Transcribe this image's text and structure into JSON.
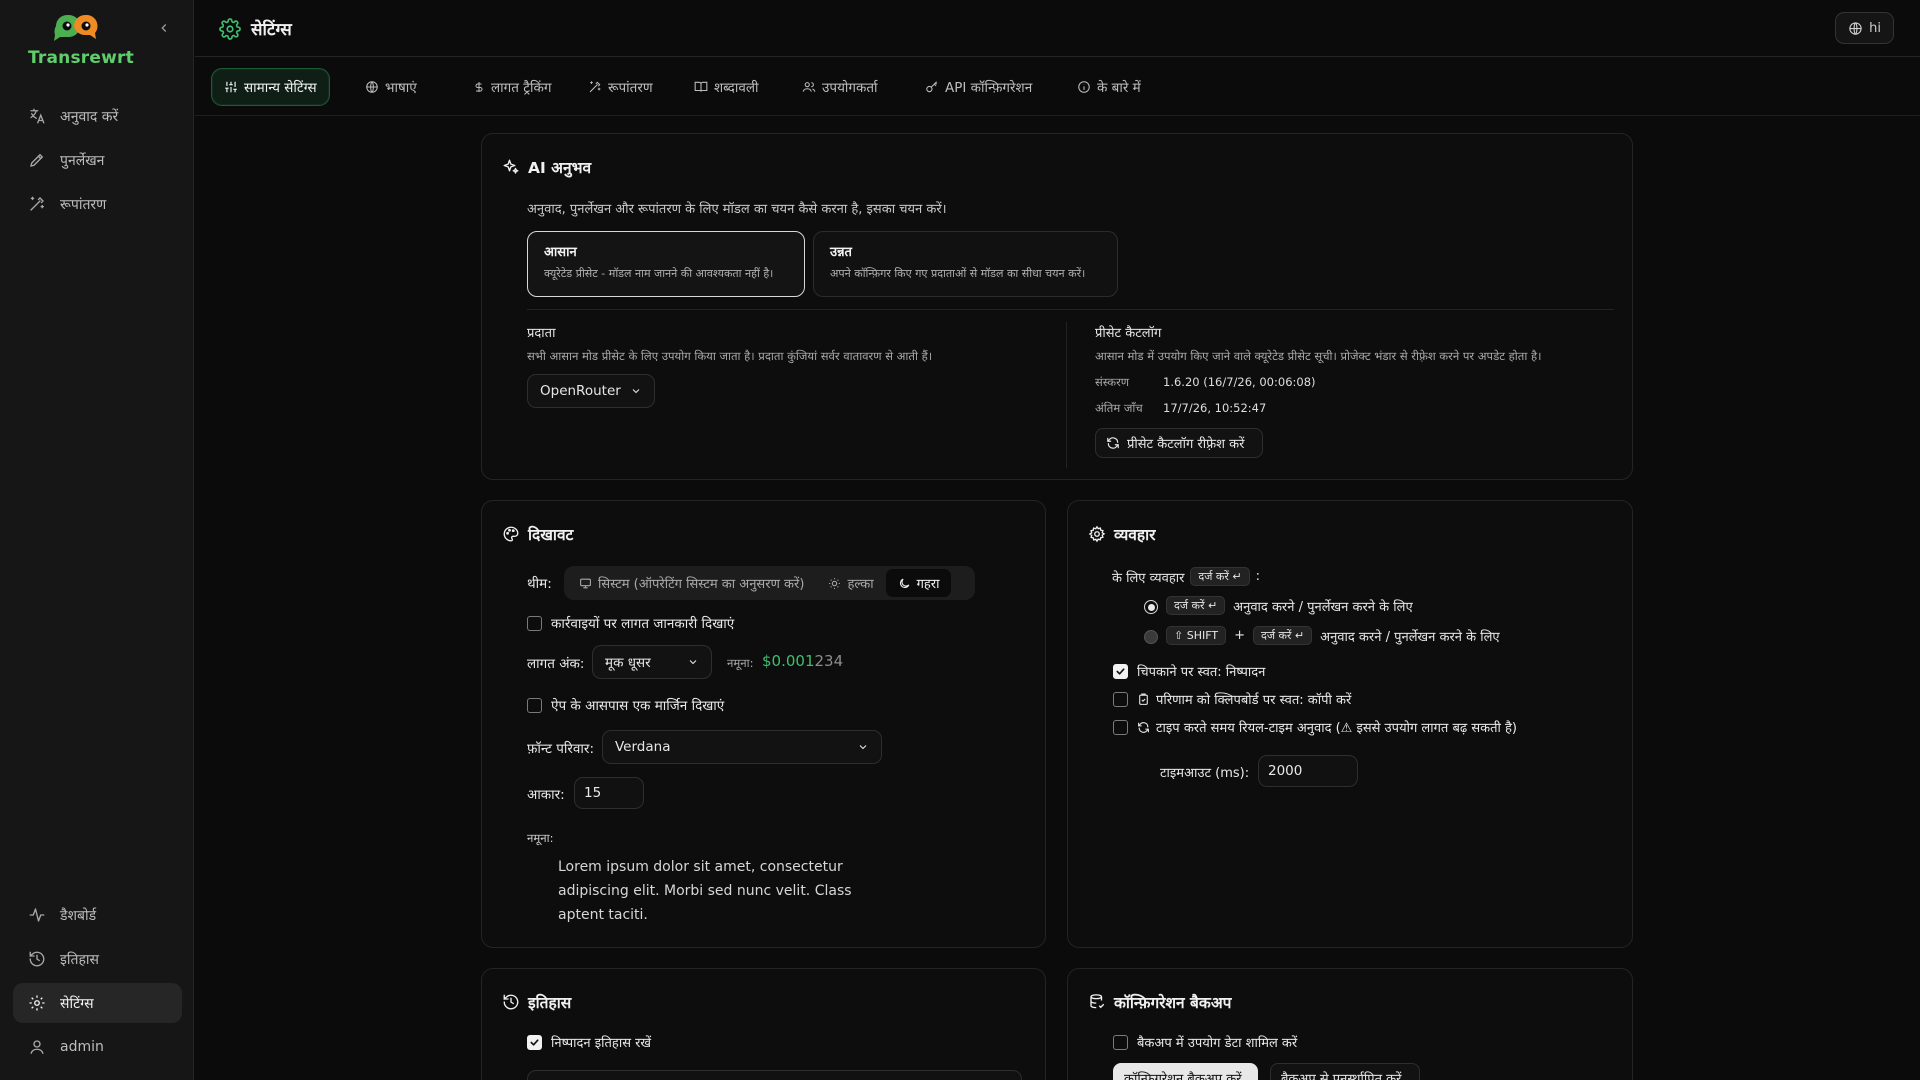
{
  "app": {
    "name": "Transrewrt",
    "brand_color": "#5fcf6b",
    "accent_color": "#3fbf6f"
  },
  "sidebar": {
    "top_items": [
      {
        "label": "अनुवाद करें",
        "icon": "translate-icon"
      },
      {
        "label": "पुनर्लेखन",
        "icon": "rewrite-icon"
      },
      {
        "label": "रूपांतरण",
        "icon": "wand-icon"
      }
    ],
    "bottom_items": [
      {
        "label": "डैशबोर्ड",
        "icon": "activity-icon"
      },
      {
        "label": "इतिहास",
        "icon": "history-icon"
      },
      {
        "label": "सेटिंग्स",
        "icon": "gear-icon",
        "active": true
      },
      {
        "label": "admin",
        "icon": "user-icon"
      }
    ]
  },
  "header": {
    "title": "सेटिंग्स",
    "language": "hi"
  },
  "tabs": [
    {
      "label": "सामान्य सेटिंग्स",
      "icon": "sliders-icon",
      "active": true
    },
    {
      "label": "भाषाएं",
      "icon": "globe-icon"
    },
    {
      "label": "लागत ट्रैकिंग",
      "icon": "dollar-icon"
    },
    {
      "label": "रूपांतरण",
      "icon": "wand-icon"
    },
    {
      "label": "शब्दावली",
      "icon": "book-icon"
    },
    {
      "label": "उपयोगकर्ता",
      "icon": "users-icon"
    },
    {
      "label": "API कॉन्फ़िगरेशन",
      "icon": "key-icon"
    },
    {
      "label": "के बारे में",
      "icon": "info-icon"
    }
  ],
  "ai": {
    "title": "AI अनुभव",
    "description": "अनुवाद, पुनर्लेखन और रूपांतरण के लिए मॉडल का चयन कैसे करना है, इसका चयन करें।",
    "modes": [
      {
        "title": "आसान",
        "desc": "क्यूरेटेड प्रीसेट - मॉडल नाम जानने की आवश्यकता नहीं है।",
        "selected": true
      },
      {
        "title": "उन्नत",
        "desc": "अपने कॉन्फ़िगर किए गए प्रदाताओं से मॉडल का सीधा चयन करें।",
        "selected": false
      }
    ],
    "provider_label": "प्रदाता",
    "provider_desc": "सभी आसान मोड प्रीसेट के लिए उपयोग किया जाता है। प्रदाता कुंजियां सर्वर वातावरण से आती हैं।",
    "provider_value": "OpenRouter",
    "catalog_label": "प्रीसेट कैटलॉग",
    "catalog_desc": "आसान मोड में उपयोग किए जाने वाले क्यूरेटेड प्रीसेट सूची। प्रोजेक्ट भंडार से रीफ़्रेश करने पर अपडेट होता है।",
    "version_label": "संस्करण",
    "version_value": "1.6.20 (16/7/26, 00:06:08)",
    "last_check_label": "अंतिम जाँच",
    "last_check_value": "17/7/26, 10:52:47",
    "refresh_button": "प्रीसेट कैटलॉग रीफ़्रेश करें"
  },
  "appearance": {
    "title": "दिखावट",
    "theme_label": "थीम:",
    "theme_options": [
      "सिस्टम (ऑपरेटिंग सिस्टम का अनुसरण करें)",
      "हल्का",
      "गहरा"
    ],
    "theme_selected": "गहरा",
    "show_cost_label": "कार्रवाइयों पर लागत जानकारी दिखाएं",
    "show_cost_checked": false,
    "cost_digits_label": "लागत अंक:",
    "cost_digits_value": "मूक धूसर",
    "sample_label": "नमूना:",
    "sample_cost_bright": "$0.001",
    "sample_cost_dim": "234",
    "sample_cost_color": "#3fbf6f",
    "margin_label": "ऐप के आसपास एक मार्जिन दिखाएं",
    "margin_checked": false,
    "font_family_label": "फ़ॉन्ट परिवार:",
    "font_family_value": "Verdana",
    "size_label": "आकार:",
    "size_value": "15",
    "preview_label": "नमूना:",
    "preview_text": "Lorem ipsum dolor sit amet, consectetur adipiscing elit. Morbi sed nunc velit. Class aptent taciti."
  },
  "behavior": {
    "title": "व्यवहार",
    "enter_prefix": "के लिए व्यवहार",
    "enter_key": "दर्ज करें ↵",
    "enter_suffix": ":",
    "option1_key": "दर्ज करें ↵",
    "option1_text": "अनुवाद करने / पुनर्लेखन करने के लिए",
    "option2_key1": "⇧ SHIFT",
    "option2_plus": "+",
    "option2_key2": "दर्ज करें ↵",
    "option2_text": "अनुवाद करने / पुनर्लेखन करने के लिए",
    "auto_exec_label": "चिपकाने पर स्वत: निष्पादन",
    "auto_exec_checked": true,
    "auto_copy_label": "परिणाम को क्लिपबोर्ड पर स्वत: कॉपी करें",
    "auto_copy_checked": false,
    "realtime_label": "टाइप करते समय रियल-टाइम अनुवाद (⚠ इससे उपयोग लागत बढ़ सकती है)",
    "realtime_checked": false,
    "timeout_label": "टाइमआउट (ms):",
    "timeout_value": "2000"
  },
  "history": {
    "title": "इतिहास",
    "keep_label": "निष्पादन इतिहास रखें",
    "keep_checked": true
  },
  "backup": {
    "title": "कॉन्फ़िगरेशन बैकअप",
    "include_usage_label": "बैकअप में उपयोग डेटा शामिल करें",
    "include_usage_checked": false,
    "backup_button": "कॉन्फ़िगरेशन बैकअप करें",
    "restore_button": "बैकअप से पुनर्स्थापित करें"
  }
}
